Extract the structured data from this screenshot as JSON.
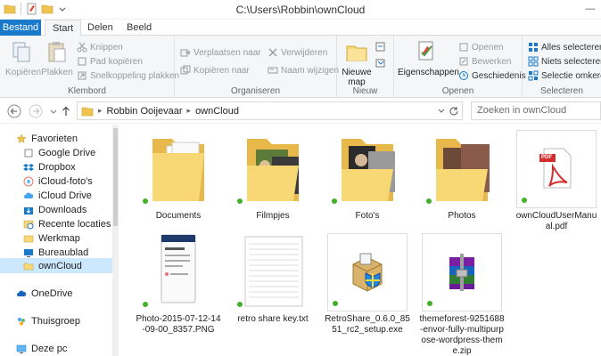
{
  "window": {
    "title": "C:\\Users\\Robbin\\ownCloud",
    "minimize": "—",
    "maximize": "☐",
    "close": "✕"
  },
  "tabs": [
    {
      "label": "Bestand"
    },
    {
      "label": "Start"
    },
    {
      "label": "Delen"
    },
    {
      "label": "Beeld"
    }
  ],
  "ribbon": {
    "klembord": {
      "label": "Klembord",
      "kopieren": "Kopiëren",
      "plakken": "Plakken",
      "knippen": "Knippen",
      "pad_kopieren": "Pad kopiëren",
      "snelkoppeling": "Snelkoppeling plakken"
    },
    "organiseren": {
      "label": "Organiseren",
      "verplaatsen": "Verplaatsen naar",
      "kopieren_naar": "Kopiëren naar",
      "verwijderen": "Verwijderen",
      "naam_wijzigen": "Naam wijzigen"
    },
    "nieuw": {
      "label": "Nieuw",
      "nieuwe_map": "Nieuwe map"
    },
    "openen": {
      "label": "Openen",
      "eigenschappen": "Eigenschappen",
      "openen": "Openen",
      "bewerken": "Bewerken",
      "geschiedenis": "Geschiedenis"
    },
    "selecteren": {
      "label": "Selecteren",
      "alles": "Alles selecteren",
      "niets": "Niets selecteren",
      "omkeren": "Selectie omkeren"
    }
  },
  "address": {
    "crumbs": [
      "Robbin Ooijevaar",
      "ownCloud"
    ],
    "search_placeholder": "Zoeken in ownCloud"
  },
  "nav": {
    "items": [
      {
        "label": "Favorieten"
      },
      {
        "label": "Google Drive"
      },
      {
        "label": "Dropbox"
      },
      {
        "label": "iCloud-foto's"
      },
      {
        "label": "iCloud Drive"
      },
      {
        "label": "Downloads"
      },
      {
        "label": "Recente locaties"
      },
      {
        "label": "Werkmap"
      },
      {
        "label": "Bureaublad"
      },
      {
        "label": "ownCloud"
      },
      {
        "label": "OneDrive"
      },
      {
        "label": "Thuisgroep"
      },
      {
        "label": "Deze pc"
      }
    ]
  },
  "files": [
    {
      "name": "Documents",
      "kind": "folder"
    },
    {
      "name": "Filmpjes",
      "kind": "folder"
    },
    {
      "name": "Foto's",
      "kind": "folder"
    },
    {
      "name": "Photos",
      "kind": "folder"
    },
    {
      "name": "ownCloudUserManual.pdf",
      "kind": "pdf",
      "badge": "PDF"
    },
    {
      "name": "Photo-2015-07-12-14-09-00_8357.PNG",
      "kind": "image"
    },
    {
      "name": "retro share key.txt",
      "kind": "text"
    },
    {
      "name": "RetroShare_0.6.0_8551_rc2_setup.exe",
      "kind": "exe"
    },
    {
      "name": "themeforest-9251688-envor-fully-multipurpose-wordpress-theme.zip",
      "kind": "zip"
    }
  ],
  "colors": {
    "accent": "#1979ca",
    "folder": "#f8d775",
    "sync": "#43b02a",
    "selected": "#cce8ff"
  }
}
